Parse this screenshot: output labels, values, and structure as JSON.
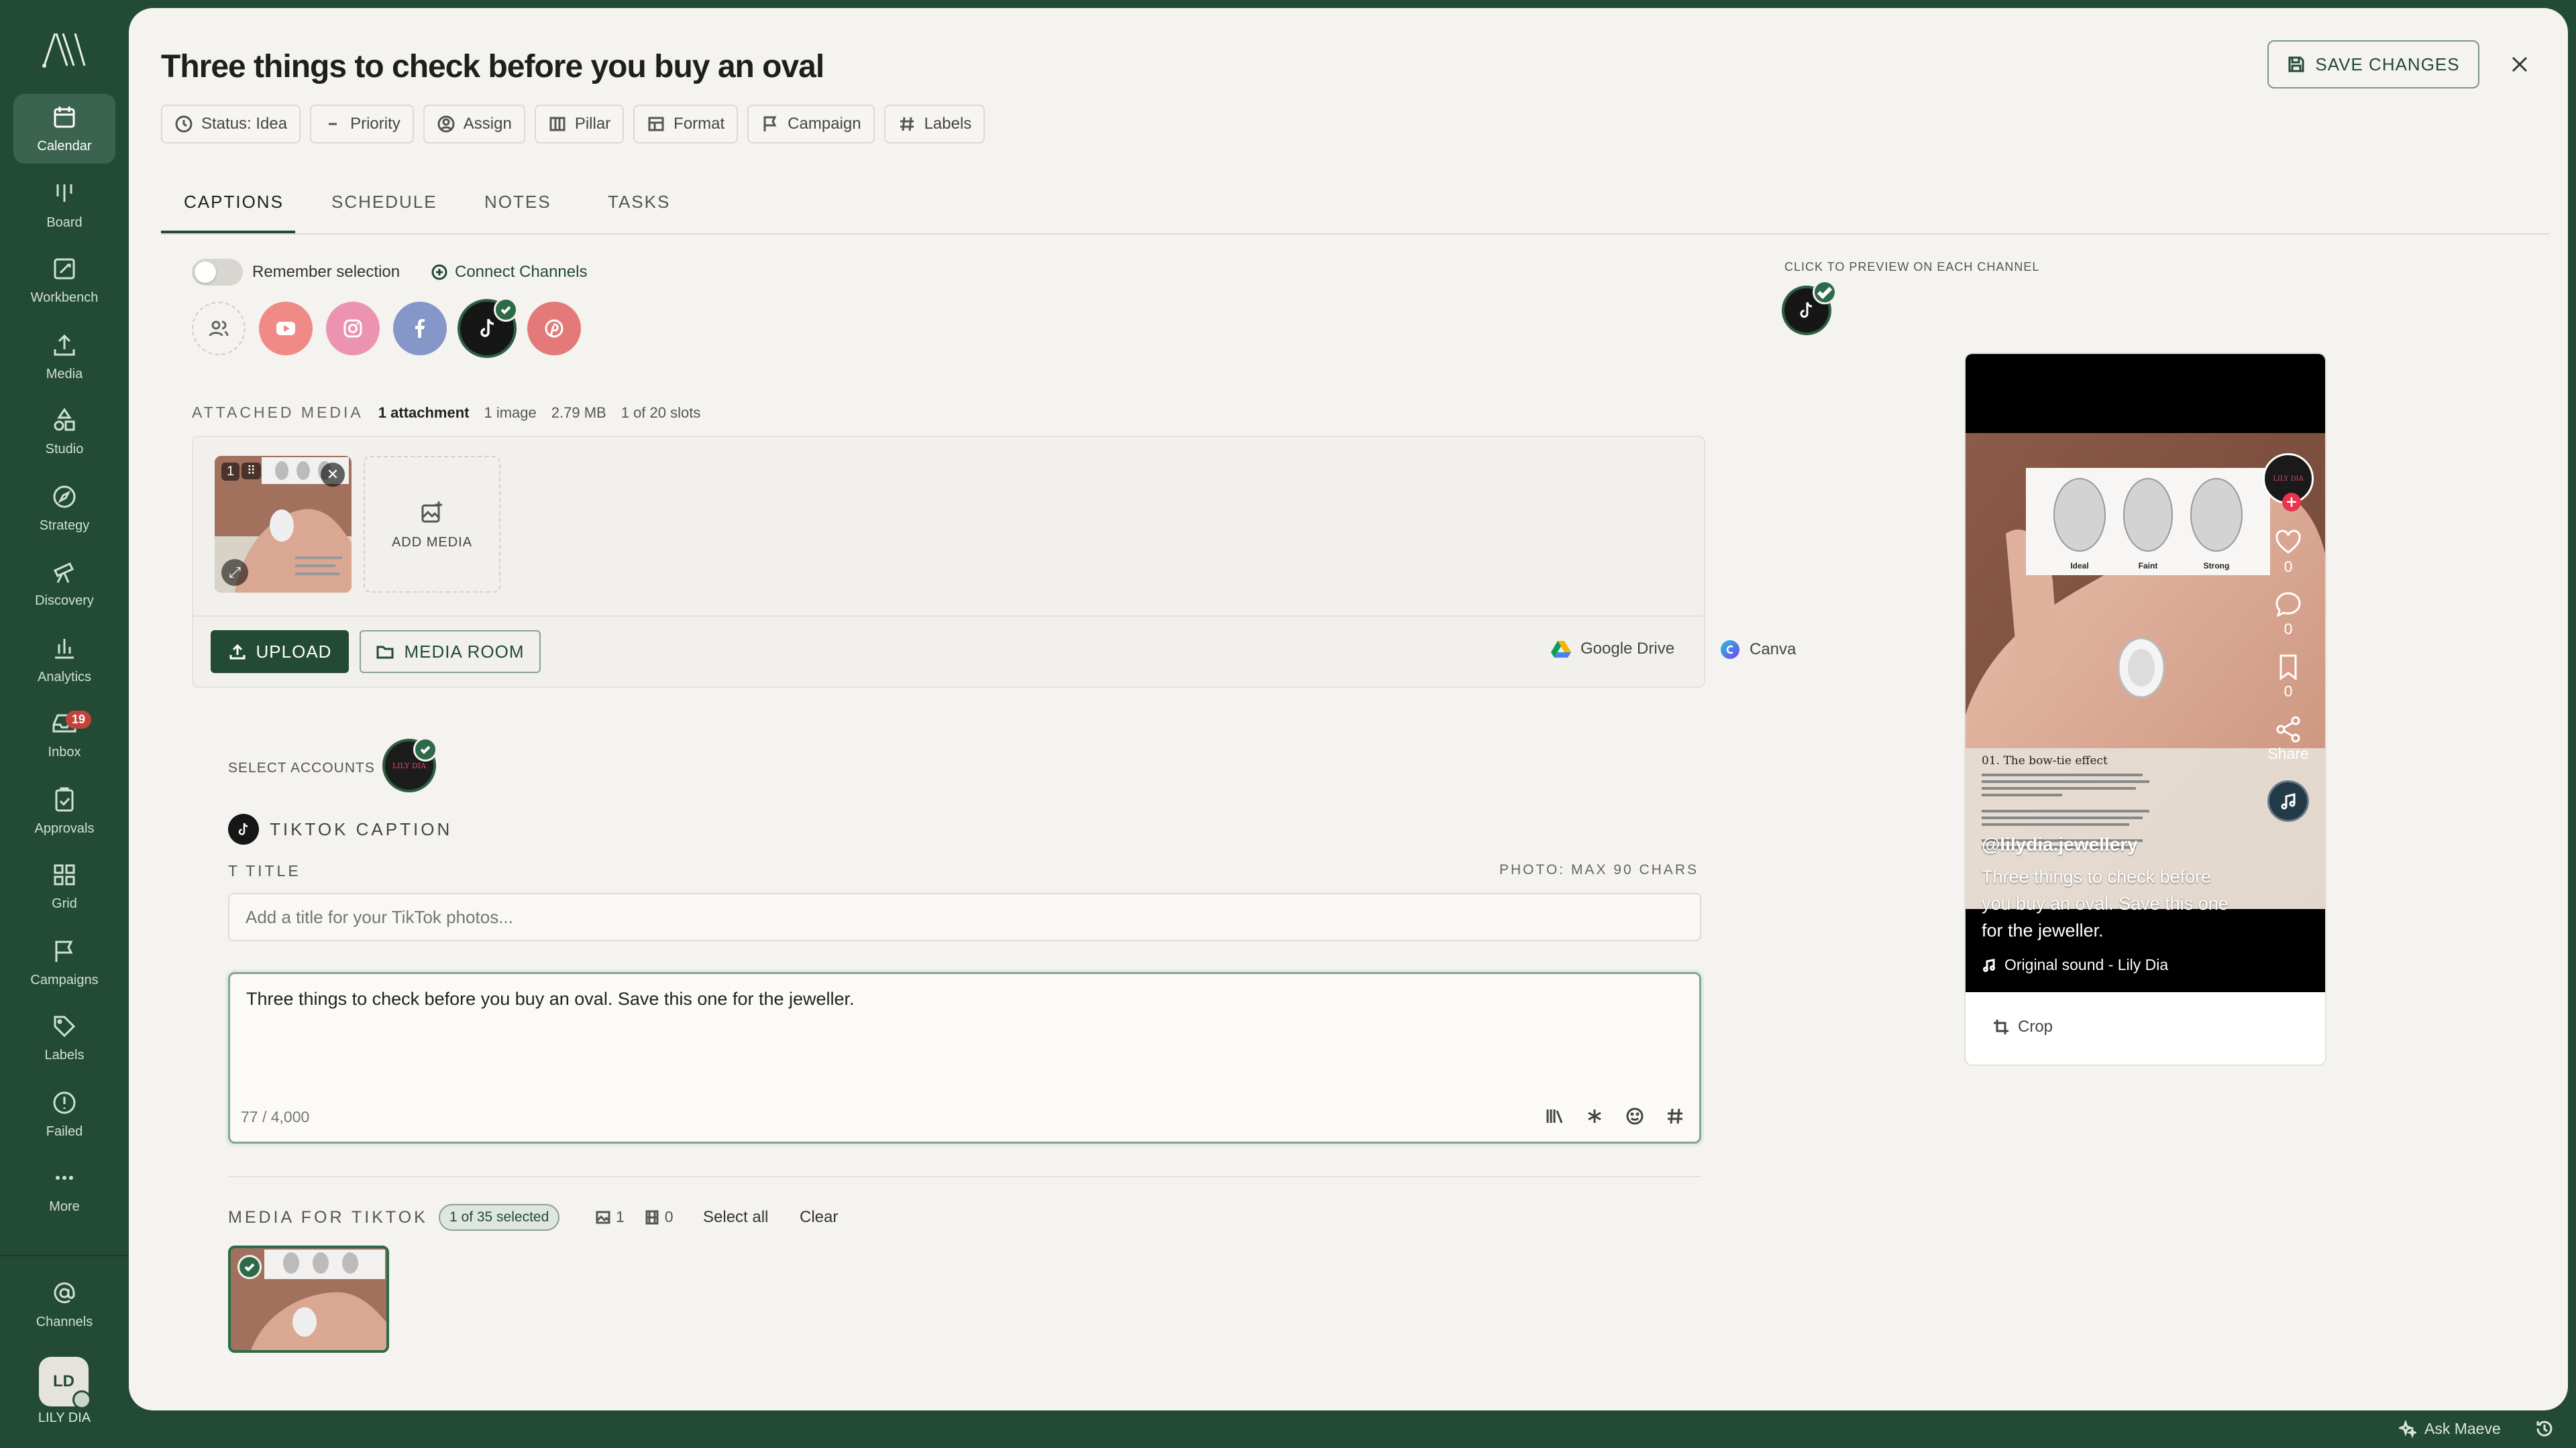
{
  "app": {
    "user_initials": "LD",
    "user_name": "LILY DIA"
  },
  "sidebar": {
    "items": [
      {
        "id": "calendar",
        "label": "Calendar",
        "icon": "calendar-icon",
        "active": true
      },
      {
        "id": "board",
        "label": "Board",
        "icon": "board-icon"
      },
      {
        "id": "workbench",
        "label": "Workbench",
        "icon": "workbench-icon"
      },
      {
        "id": "media",
        "label": "Media",
        "icon": "upload-icon"
      },
      {
        "id": "studio",
        "label": "Studio",
        "icon": "shapes-icon"
      },
      {
        "id": "strategy",
        "label": "Strategy",
        "icon": "compass-icon"
      },
      {
        "id": "discovery",
        "label": "Discovery",
        "icon": "telescope-icon"
      },
      {
        "id": "analytics",
        "label": "Analytics",
        "icon": "bar-chart-icon"
      },
      {
        "id": "inbox",
        "label": "Inbox",
        "icon": "inbox-icon",
        "badge": "19"
      },
      {
        "id": "approvals",
        "label": "Approvals",
        "icon": "clipboard-check-icon"
      },
      {
        "id": "grid",
        "label": "Grid",
        "icon": "grid-icon"
      },
      {
        "id": "campaigns",
        "label": "Campaigns",
        "icon": "flag-icon"
      },
      {
        "id": "labels",
        "label": "Labels",
        "icon": "tag-icon"
      },
      {
        "id": "failed",
        "label": "Failed",
        "icon": "alert-circle-icon"
      },
      {
        "id": "more",
        "label": "More",
        "icon": "more-icon"
      }
    ],
    "channels_label": "Channels"
  },
  "header": {
    "title": "Three things to check before you buy an oval",
    "save_label": "SAVE CHANGES",
    "chips": {
      "status": "Status: Idea",
      "priority": "Priority",
      "assign": "Assign",
      "pillar": "Pillar",
      "format": "Format",
      "campaign": "Campaign",
      "labels": "Labels"
    }
  },
  "tabs": {
    "captions": "CAPTIONS",
    "schedule": "SCHEDULE",
    "notes": "NOTES",
    "tasks": "TASKS"
  },
  "channels": {
    "remember_label": "Remember selection",
    "remember_on": false,
    "connect_label": "Connect Channels"
  },
  "attached_media": {
    "label": "ATTACHED MEDIA",
    "count": "1 attachment",
    "images": "1 image",
    "size": "2.79 MB",
    "slots": "1 of 20 slots",
    "thumb_index": "1",
    "add_label": "ADD MEDIA",
    "upload_label": "UPLOAD",
    "room_label": "MEDIA ROOM",
    "gdrive_label": "Google Drive",
    "canva_label": "Canva"
  },
  "accounts": {
    "label": "SELECT ACCOUNTS",
    "avatar_text": "LILY DIA"
  },
  "tiktok": {
    "caption_label": "TIKTOK CAPTION",
    "title_label": "TITLE",
    "title_hint": "PHOTO: MAX 90 CHARS",
    "title_placeholder": "Add a title for your TikTok photos...",
    "caption_text": "Three things to check before you buy an oval. Save this one for the jeweller.",
    "char_count": "77 / 4,000"
  },
  "media_for_tiktok": {
    "label": "MEDIA FOR TIKTOK",
    "selected": "1 of 35 selected",
    "image_count": "1",
    "video_count": "0",
    "select_all": "Select all",
    "clear": "Clear"
  },
  "preview": {
    "label": "CLICK TO PREVIEW ON EACH CHANNEL",
    "handle": "@lilydia.jewellery",
    "caption": "Three things to check before you buy an oval. Save this one for the jeweller.",
    "sound": "Original sound - Lily Dia",
    "likes": "0",
    "comments": "0",
    "saves": "0",
    "share_label": "Share",
    "crop_label": "Crop",
    "avatar_text": "LILY DIA",
    "diamond_labels": [
      "Ideal",
      "Faint",
      "Strong"
    ],
    "article_heading": "01. The bow-tie effect"
  },
  "footer": {
    "ask_label": "Ask Maeve"
  },
  "colors": {
    "brand": "#234a35",
    "accent": "#2d6a48",
    "badge": "#c1443a",
    "tiktok_red": "#e8344e"
  }
}
